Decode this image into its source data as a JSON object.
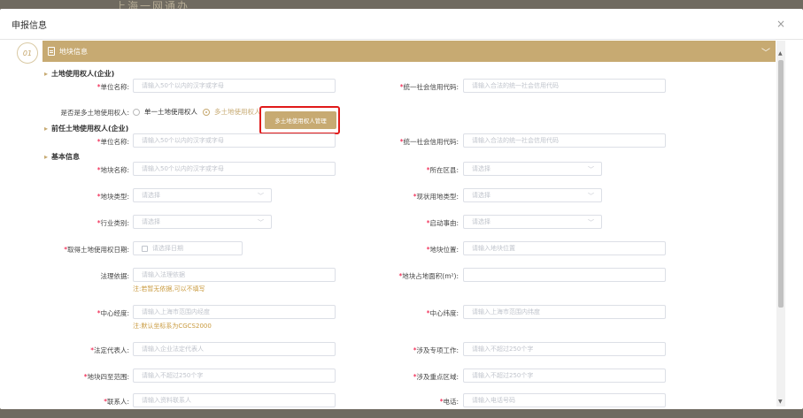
{
  "backdrop": {
    "title": "上海一网通办"
  },
  "modal": {
    "title": "申报信息",
    "close": "×"
  },
  "step": {
    "number": "01"
  },
  "section": {
    "title": "地块信息",
    "chevron": "﹀"
  },
  "groups": {
    "land_user": "土地使用权人(企业)",
    "former_user": "前任土地使用权人(企业)",
    "basic": "基本信息"
  },
  "land_user": {
    "unit_label": "单位名称:",
    "unit_placeholder": "请输入50个以内的汉字或字母",
    "credit_label": "统一社会信用代码:",
    "credit_placeholder": "请输入合法的统一社会信用代码"
  },
  "multi_owner": {
    "label": "是否是多土地使用权人:",
    "option_single": "单一土地使用权人",
    "option_multi": "多土地使用权人",
    "selected": "multi",
    "manage_button": "多土地使用权人管理"
  },
  "former_user": {
    "unit_label": "单位名称:",
    "unit_placeholder": "请输入50个以内的汉字或字母",
    "credit_label": "统一社会信用代码:",
    "credit_placeholder": "请输入合法的统一社会信用代码"
  },
  "basic": {
    "plot_name_label": "地块名称:",
    "plot_name_placeholder": "请输入50个以内的汉字或字母",
    "district_label": "所在区县:",
    "district_placeholder": "请选择",
    "plot_type_label": "地块类型:",
    "plot_type_placeholder": "请选择",
    "land_use_label": "现状用地类型:",
    "land_use_placeholder": "请选择",
    "industry_label": "行业类别:",
    "industry_placeholder": "请选择",
    "reason_label": "启动事由:",
    "reason_placeholder": "请选择",
    "date_label": "取得土地使用权日期:",
    "date_placeholder": "请选择日期",
    "location_label": "地块位置:",
    "location_placeholder": "请输入地块位置",
    "legal_basis_label": "法理依据:",
    "legal_basis_placeholder": "请输入法理依据",
    "legal_basis_hint": "注:若暂无依据,可以不填写",
    "area_label": "地块占地面积(m²):",
    "area_placeholder": "",
    "center_lng_label": "中心经度:",
    "center_lng_placeholder": "请输入上海市范围内经度",
    "center_hint": "注:默认坐标系为CGCS2000",
    "center_lat_label": "中心纬度:",
    "center_lat_placeholder": "请输入上海市范围内纬度",
    "legal_rep_label": "法定代表人:",
    "legal_rep_placeholder": "请输入企业法定代表人",
    "special_work_label": "涉及专项工作:",
    "special_work_placeholder": "请输入不超过250个字",
    "boundary_label": "地块四至范围:",
    "boundary_placeholder": "请输入不超过250个字",
    "key_area_label": "涉及重点区域:",
    "key_area_placeholder": "请输入不超过250个字",
    "contact_label": "联系人:",
    "contact_placeholder": "请输入资料联系人",
    "phone_label": "电话:",
    "phone_placeholder": "请输入电话号码"
  },
  "colors": {
    "accent": "#c7aa72",
    "highlight": "#e01a1a",
    "required": "#ee0033",
    "hint": "#c99a3e"
  }
}
